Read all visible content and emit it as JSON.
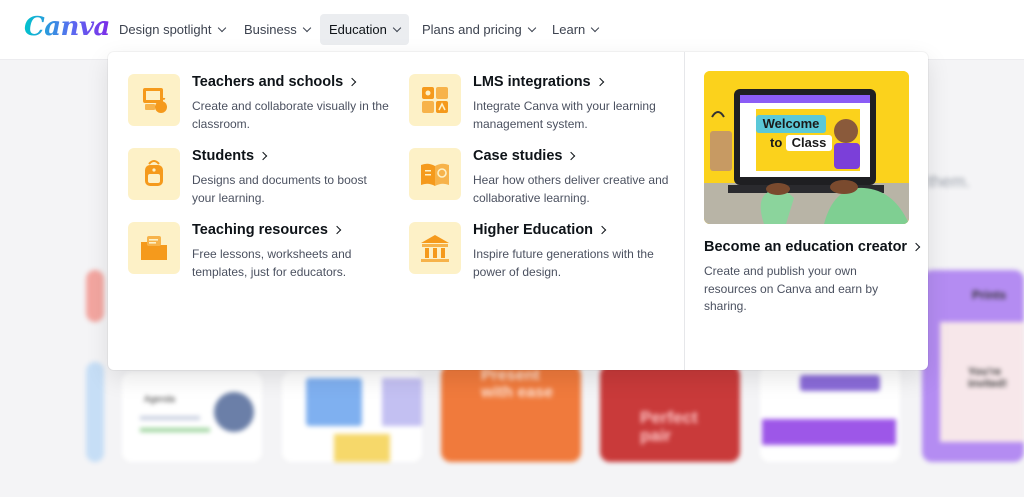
{
  "brand": {
    "logo_text": "Canva"
  },
  "nav": {
    "items": [
      {
        "label": "Design spotlight"
      },
      {
        "label": "Business"
      },
      {
        "label": "Education"
      },
      {
        "label": "Plans and pricing"
      },
      {
        "label": "Learn"
      }
    ]
  },
  "dropdown": {
    "items": [
      {
        "title": "Teachers and schools",
        "desc": "Create and collaborate visually in the classroom.",
        "icon": "classroom-icon"
      },
      {
        "title": "Students",
        "desc": "Designs and documents to boost your learning.",
        "icon": "backpack-icon"
      },
      {
        "title": "Teaching resources",
        "desc": "Free lessons, worksheets and templates, just for educators.",
        "icon": "folder-icon"
      },
      {
        "title": "LMS integrations",
        "desc": "Integrate Canva with your learning management system.",
        "icon": "lms-blocks-icon"
      },
      {
        "title": "Case studies",
        "desc": "Hear how others deliver creative and collaborative learning.",
        "icon": "book-icon"
      },
      {
        "title": "Higher Education",
        "desc": "Inspire future generations with the power of design.",
        "icon": "university-icon"
      }
    ],
    "feature": {
      "title": "Become an education creator",
      "desc": "Create and publish your own resources on Canva and earn by sharing.",
      "image_text": {
        "line1": "Welcome",
        "line2a": "to ",
        "line2b": "Class"
      }
    }
  },
  "background": {
    "partial_text": "t them.",
    "card_texts": {
      "present": "Present with ease",
      "perfect": "Perfect pair",
      "agenda": "Agenda",
      "prints": "Prints",
      "invited": "You're invited!"
    }
  },
  "colors": {
    "accent": "#7d2ae8",
    "brand_teal": "#00c4cc",
    "icon_bg": "#fdf1c7",
    "icon_orange": "#f59a1c",
    "feature_yellow": "#fbd21c"
  }
}
